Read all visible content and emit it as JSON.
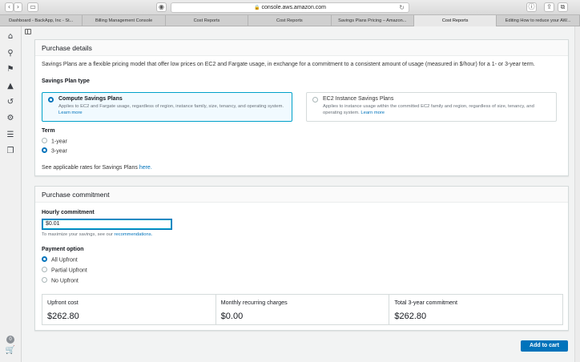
{
  "browser": {
    "url": "console.aws.amazon.com",
    "tabs": [
      {
        "label": "Dashboard - BackApp, Inc - St...",
        "active": false
      },
      {
        "label": "Billing Management Console",
        "active": false
      },
      {
        "label": "Cost Reports",
        "active": false
      },
      {
        "label": "Cost Reports",
        "active": false
      },
      {
        "label": "Savings Plans Pricing – Amazon...",
        "active": false
      },
      {
        "label": "Cost Reports",
        "active": true
      },
      {
        "label": "Editing How to reduce your AW...",
        "active": false
      }
    ]
  },
  "rail": {
    "icons": [
      "home-icon",
      "search-icon",
      "flag-icon",
      "alert-icon",
      "history-icon",
      "settings-gear-icon",
      "list-icon",
      "documents-icon"
    ],
    "cart_count": "0"
  },
  "purchase_details": {
    "header": "Purchase details",
    "description": "Savings Plans are a flexible pricing model that offer low prices on EC2 and Fargate usage, in exchange for a commitment to a consistent amount of usage (measured in $/hour) for a 1- or 3-year term.",
    "type_label": "Savings Plan type",
    "compute": {
      "title": "Compute Savings Plans",
      "desc": "Applies to EC2 and Fargate usage, regardless of region, instance family, size, tenancy, and operating system.",
      "link": "Learn more"
    },
    "ec2": {
      "title": "EC2 Instance Savings Plans",
      "desc": "Applies to instance usage within the committed EC2 family and region, regardless of size, tenancy, and operating system.",
      "link": "Learn more"
    },
    "term_label": "Term",
    "term_1": "1-year",
    "term_3": "3-year",
    "rates_text": "See applicable rates for Savings Plans",
    "rates_link": "here."
  },
  "commitment": {
    "header": "Purchase commitment",
    "hourly_label": "Hourly commitment",
    "hourly_value": "$0.01",
    "hint_text": "To maximize your savings, see our",
    "hint_link": "recommendations.",
    "payment_label": "Payment option",
    "options": [
      "All Upfront",
      "Partial Upfront",
      "No Upfront"
    ],
    "summary": [
      {
        "label": "Upfront cost",
        "value": "$262.80"
      },
      {
        "label": "Monthly recurring charges",
        "value": "$0.00"
      },
      {
        "label": "Total 3-year commitment",
        "value": "$262.80"
      }
    ]
  },
  "add_to_cart": "Add to cart"
}
